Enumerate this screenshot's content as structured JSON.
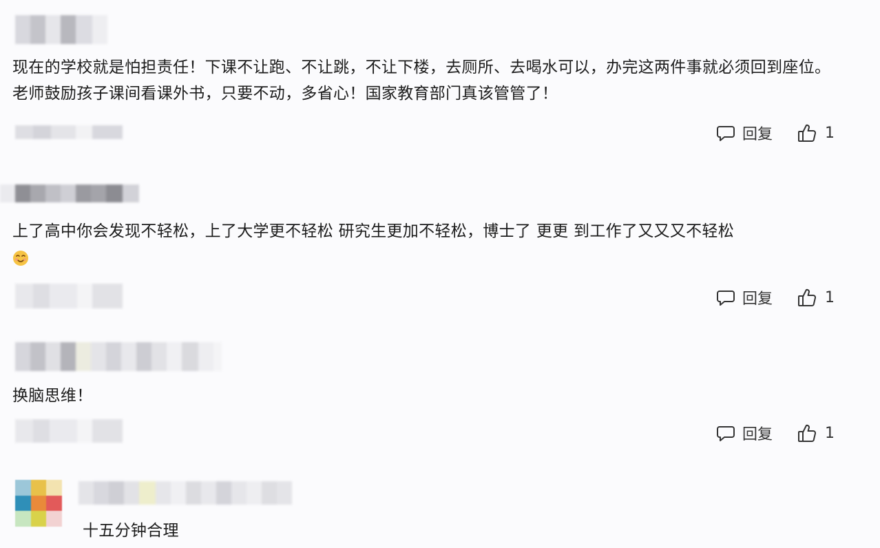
{
  "comments": [
    {
      "text": "现在的学校就是怕担责任！下课不让跑、不让跳，不让下楼，去厕所、去喝水可以，办完这两件事就必须回到座位。老师鼓励孩子课间看课外书，只要不动，多省心！国家教育部门真该管管了！",
      "reply_label": "回复",
      "like_count": "1"
    },
    {
      "text": "上了高中你会发现不轻松，上了大学更不轻松 研究生更加不轻松，博士了 更更 到工作了又又又不轻松",
      "emoji": "smiling-face-icon",
      "reply_label": "回复",
      "like_count": "1"
    },
    {
      "text": "换脑思维！",
      "reply_label": "回复",
      "like_count": "1"
    },
    {
      "text": "十五分钟合理"
    }
  ],
  "colors": {
    "background": "#fbfbfd",
    "text": "#1c1c1c",
    "icon": "#333333",
    "blur_light": "#e6e6ea",
    "blur_mid": "#c9c9cf",
    "blur_dark": "#9a9aa0"
  }
}
